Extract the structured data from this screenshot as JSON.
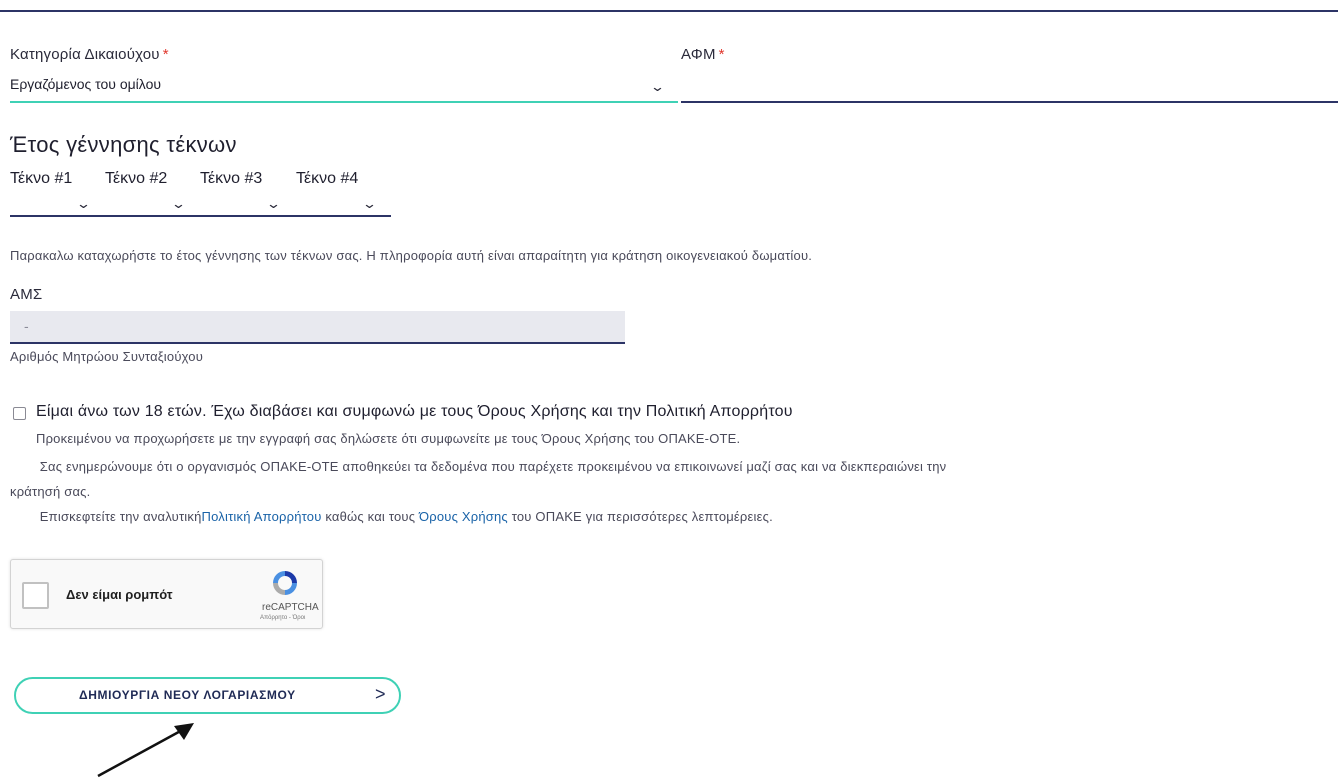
{
  "form": {
    "category": {
      "label": "Κατηγορία Δικαιούχου",
      "required_mark": "*",
      "value": "Εργαζόμενος του ομίλου"
    },
    "afm": {
      "label": "ΑΦΜ",
      "required_mark": "*",
      "value": ""
    },
    "children": {
      "heading": "Έτος γέννησης τέκνων",
      "labels": [
        "Τέκνο #1",
        "Τέκνο #2",
        "Τέκνο #3",
        "Τέκνο #4"
      ],
      "help": "Παρακαλω καταχωρήστε το έτος γέννησης των τέκνων σας. Η πληροφορία αυτή είναι απαραίτητη για κράτηση οικογενειακού δωματίου."
    },
    "ams": {
      "label": "ΑΜΣ",
      "value": "-",
      "help": "Αριθμός Μητρώου Συνταξιούχου"
    },
    "terms": {
      "title": "Είμαι άνω των 18 ετών. Έχω διαβάσει και συμφωνώ με τους Όρους Χρήσης και την Πολιτική Απορρήτου",
      "line1": "Προκειμένου να προχωρήσετε με την εγγραφή σας δηλώσετε ότι συμφωνείτε με τους Όρους Χρήσης του ΟΠΑΚΕ-ΟΤΕ.",
      "line2a": " Σας ενημερώνουμε ότι ο οργανισμός ΟΠΑΚΕ-ΟΤΕ αποθηκεύει τα δεδομένα που παρέχετε προκειμένου να επικοινωνεί μαζί σας και να διεκπεραιώνει την",
      "line2b": "κράτησή σας.",
      "line3_prefix": " Επισκεφτείτε την αναλυτική",
      "link_privacy": "Πολιτική Απορρήτου",
      "line3_mid": " καθώς και τους ",
      "link_terms": "Όρους Χρήσης",
      "line3_suffix": " του ΟΠΑΚΕ για περισσότερες λεπτομέρειες."
    },
    "captcha": {
      "label": "Δεν είμαι ρομπότ",
      "brand": "reCAPTCHA",
      "small": "Απόρρητο - Όροι"
    },
    "submit": {
      "label": "ΔΗΜΙΟΥΡΓΙΑ ΝΕΟΥ ΛΟΓΑΡΙΑΣΜΟΥ"
    }
  },
  "colors": {
    "accent": "#3fd1b5",
    "navy": "#2c3466",
    "required": "#e0362c",
    "link": "#1a63a8"
  }
}
